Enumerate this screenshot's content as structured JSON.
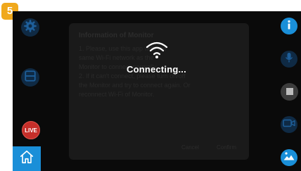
{
  "step_badge": "5",
  "overlay": {
    "status_text": "Connecting..."
  },
  "dialog": {
    "title": "Information of Monitor",
    "body_lines": [
      "1. Please, use this app with the",
      "same Wi-Fi network as the",
      "Monitor to connect normally.",
      "2. If it can't connect, please turn on/off",
      "the Monitor and try to connect again. Or",
      "reconnect Wi-Fi of Monitor."
    ],
    "cancel_label": "Cancel",
    "confirm_label": "Confirm"
  },
  "left_sidebar": {
    "live_label": "LIVE"
  },
  "colors": {
    "accent_blue": "#1a8fd8",
    "live_red": "#c62f2a",
    "step_badge": "#f0a81c",
    "screen_bg": "#0a0a0a"
  },
  "icons": [
    "gear-icon",
    "split-screen-icon",
    "live-icon",
    "home-icon",
    "info-icon",
    "microphone-icon",
    "stop-icon",
    "video-camera-icon",
    "gallery-icon",
    "wifi-icon"
  ]
}
